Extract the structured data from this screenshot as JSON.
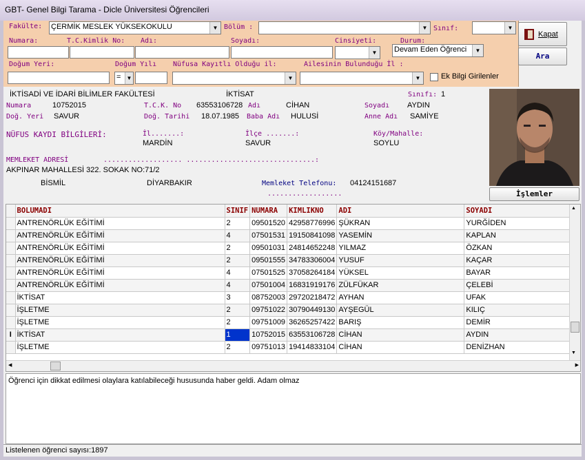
{
  "window": {
    "title": "GBT- Genel Bilgi Tarama - Dicle Üniversitesi Öğrencileri"
  },
  "filter": {
    "fakulte_label": "Fakülte:",
    "fakulte_value": "ÇERMİK MESLEK YÜKSEKOKULU",
    "bolum_label": "Bölüm :",
    "bolum_value": "",
    "sinif_label": "Sınıf:",
    "sinif_value": "",
    "numara_label": "Numara:",
    "tc_label": "T.C.Kimlik No:",
    "adi_label": "Adı:",
    "soyadi_label": "Soyadı:",
    "cinsiyet_label": "Cinsiyeti:",
    "durum_label": "Durum:",
    "durum_value": "Devam Eden Öğrenci",
    "dogum_yeri_label": "Doğum Yeri:",
    "dogum_yili_label": "Doğum Yılı",
    "dogum_yili_op": "=",
    "nufus_label": "Nüfusa Kayıtlı Olduğu il:",
    "aile_label": "Ailesinin Bulunduğu İl :",
    "ek_bilgi_label": "Ek Bilgi Girilenler",
    "kapat_label": "Kapat",
    "ara_label": "Ara"
  },
  "student": {
    "fakulte": "İKTİSADİ VE İDARİ BİLİMLER FAKÜLTESİ",
    "bolum": "İKTİSAT",
    "sinif_label": "Sınıfı:",
    "sinif": "1",
    "numara_label": "Numara",
    "numara": "10752015",
    "tck_label": "T.C.K. No",
    "tck": "63553106728",
    "adi_label": "Adı",
    "adi": "CİHAN",
    "soyadi_label": "Soyadı",
    "soyadi": "AYDIN",
    "dogyeri_label": "Doğ. Yeri",
    "dogyeri": "SAVUR",
    "dogtarihi_label": "Doğ. Tarihi",
    "dogtarihi": "18.07.1985",
    "baba_label": "Baba Adı",
    "baba": "HULUSİ",
    "anne_label": "Anne Adı",
    "anne": "SAMİYE",
    "nufus_title": "NÜFUS KAYDI BİLGİLERİ:",
    "il_label": "İl.......:",
    "il": "MARDİN",
    "ilce_label": "İlçe .......:",
    "ilce": "SAVUR",
    "koy_label": "Köy/Mahalle:",
    "koy": "SOYLU",
    "memleket_title": "MEMLEKET ADRESİ",
    "memleket_dots": "................... ...............................:",
    "adres": "AKPINAR MAHALLESİ 322. SOKAK NO:71/2",
    "adres_ilce": "BİSMİL",
    "adres_il": "DİYARBAKIR",
    "tel_label": "Memleket Telefonu:",
    "tel": "04124151687",
    "tel_dots": "..................",
    "islemler_label": "İşlemler"
  },
  "grid": {
    "columns": [
      "BOLUMADI",
      "SINIF",
      "NUMARA",
      "KIMLIKNO",
      "ADI",
      "SOYADI"
    ],
    "rows": [
      [
        "ANTRENÖRLÜK EĞİTİMİ",
        "2",
        "09501520",
        "42958776996",
        "ŞÜKRAN",
        "YURĞİDEN"
      ],
      [
        "ANTRENÖRLÜK EĞİTİMİ",
        "4",
        "07501531",
        "19150841098",
        "YASEMİN",
        "KAPLAN"
      ],
      [
        "ANTRENÖRLÜK EĞİTİMİ",
        "2",
        "09501031",
        "24814652248",
        "YILMAZ",
        "ÖZKAN"
      ],
      [
        "ANTRENÖRLÜK EĞİTİMİ",
        "2",
        "09501555",
        "34783306004",
        "YUSUF",
        "KAÇAR"
      ],
      [
        "ANTRENÖRLÜK EĞİTİMİ",
        "4",
        "07501525",
        "37058264184",
        "YÜKSEL",
        "BAYAR"
      ],
      [
        "ANTRENÖRLÜK EĞİTİMİ",
        "4",
        "07501004",
        "16831919176",
        "ZÜLFÜKAR",
        "ÇELEBİ"
      ],
      [
        "İKTİSAT",
        "3",
        "08752003",
        "29720218472",
        "AYHAN",
        "UFAK"
      ],
      [
        "İŞLETME",
        "2",
        "09751022",
        "30790449130",
        "AYŞEGÜL",
        "KILIÇ"
      ],
      [
        "İŞLETME",
        "2",
        "09751009",
        "36265257422",
        "BARIŞ",
        "DEMİR"
      ],
      [
        "İKTİSAT",
        "1",
        "10752015",
        "63553106728",
        "CİHAN",
        "AYDIN"
      ],
      [
        "İŞLETME",
        "2",
        "09751013",
        "19414833104",
        "CİHAN",
        "DENİZHAN"
      ]
    ],
    "selected_row": 9,
    "row_indicator": "I"
  },
  "note": {
    "text": "Öğrenci için dikkat edilmesi olaylara katılabileceği hususunda haber geldi. Adam olmaz"
  },
  "status": {
    "text": "Listelenen öğrenci sayısı:1897"
  }
}
